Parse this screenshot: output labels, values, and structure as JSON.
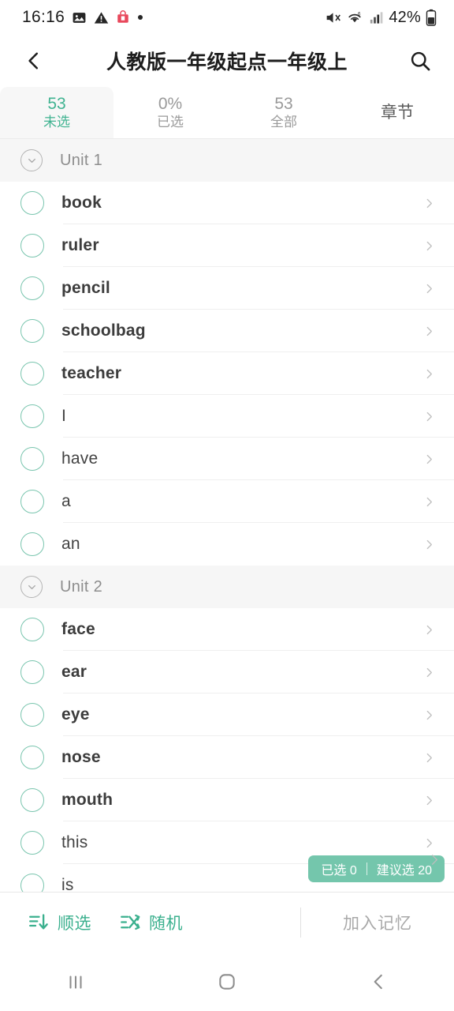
{
  "status_bar": {
    "time": "16:16",
    "battery_percent": "42%",
    "icons": [
      "photo-icon",
      "warning-icon",
      "app-notification-icon",
      "dot-icon",
      "mute-icon",
      "wifi-icon",
      "signal-icon",
      "battery-icon"
    ]
  },
  "app_bar": {
    "back_icon": "back-chevron-icon",
    "title": "人教版一年级起点一年级上",
    "search_icon": "search-icon"
  },
  "tabs": [
    {
      "num": "53",
      "label": "未选",
      "selected": true
    },
    {
      "num": "0%",
      "label": "已选",
      "selected": false
    },
    {
      "num": "53",
      "label": "全部",
      "selected": false
    },
    {
      "num": "",
      "label": "章节",
      "selected": false,
      "single": true
    }
  ],
  "sections": [
    {
      "title": "Unit 1",
      "collapse_icon": "chevron-down-circle-icon",
      "words": [
        {
          "text": "book",
          "bold": true,
          "checked": false
        },
        {
          "text": "ruler",
          "bold": true,
          "checked": false
        },
        {
          "text": "pencil",
          "bold": true,
          "checked": false
        },
        {
          "text": "schoolbag",
          "bold": true,
          "checked": false
        },
        {
          "text": "teacher",
          "bold": true,
          "checked": false
        },
        {
          "text": "I",
          "bold": false,
          "checked": false
        },
        {
          "text": "have",
          "bold": false,
          "checked": false
        },
        {
          "text": "a",
          "bold": false,
          "checked": false
        },
        {
          "text": "an",
          "bold": false,
          "checked": false
        }
      ]
    },
    {
      "title": "Unit 2",
      "collapse_icon": "chevron-down-circle-icon",
      "words": [
        {
          "text": "face",
          "bold": true,
          "checked": false
        },
        {
          "text": "ear",
          "bold": true,
          "checked": false
        },
        {
          "text": "eye",
          "bold": true,
          "checked": false
        },
        {
          "text": "nose",
          "bold": true,
          "checked": false
        },
        {
          "text": "mouth",
          "bold": true,
          "checked": false
        },
        {
          "text": "this",
          "bold": false,
          "checked": false
        },
        {
          "text": "is",
          "bold": false,
          "checked": false
        }
      ]
    }
  ],
  "selection_badge": {
    "selected_text": "已选 0",
    "suggest_text": "建议选 20"
  },
  "toolbar": {
    "sort_icon": "sort-descending-icon",
    "sort_label": "顺选",
    "shuffle_icon": "shuffle-icon",
    "shuffle_label": "随机",
    "memory_label": "加入记忆"
  },
  "nav_bar": {
    "recents_icon": "recents-icon",
    "home_icon": "home-icon",
    "back_icon": "nav-back-icon"
  },
  "colors": {
    "accent_teal": "#3bb08e",
    "circle_teal": "#79c5ae",
    "badge_teal": "#74c6ac",
    "muted_gray": "#9a9a9a"
  }
}
